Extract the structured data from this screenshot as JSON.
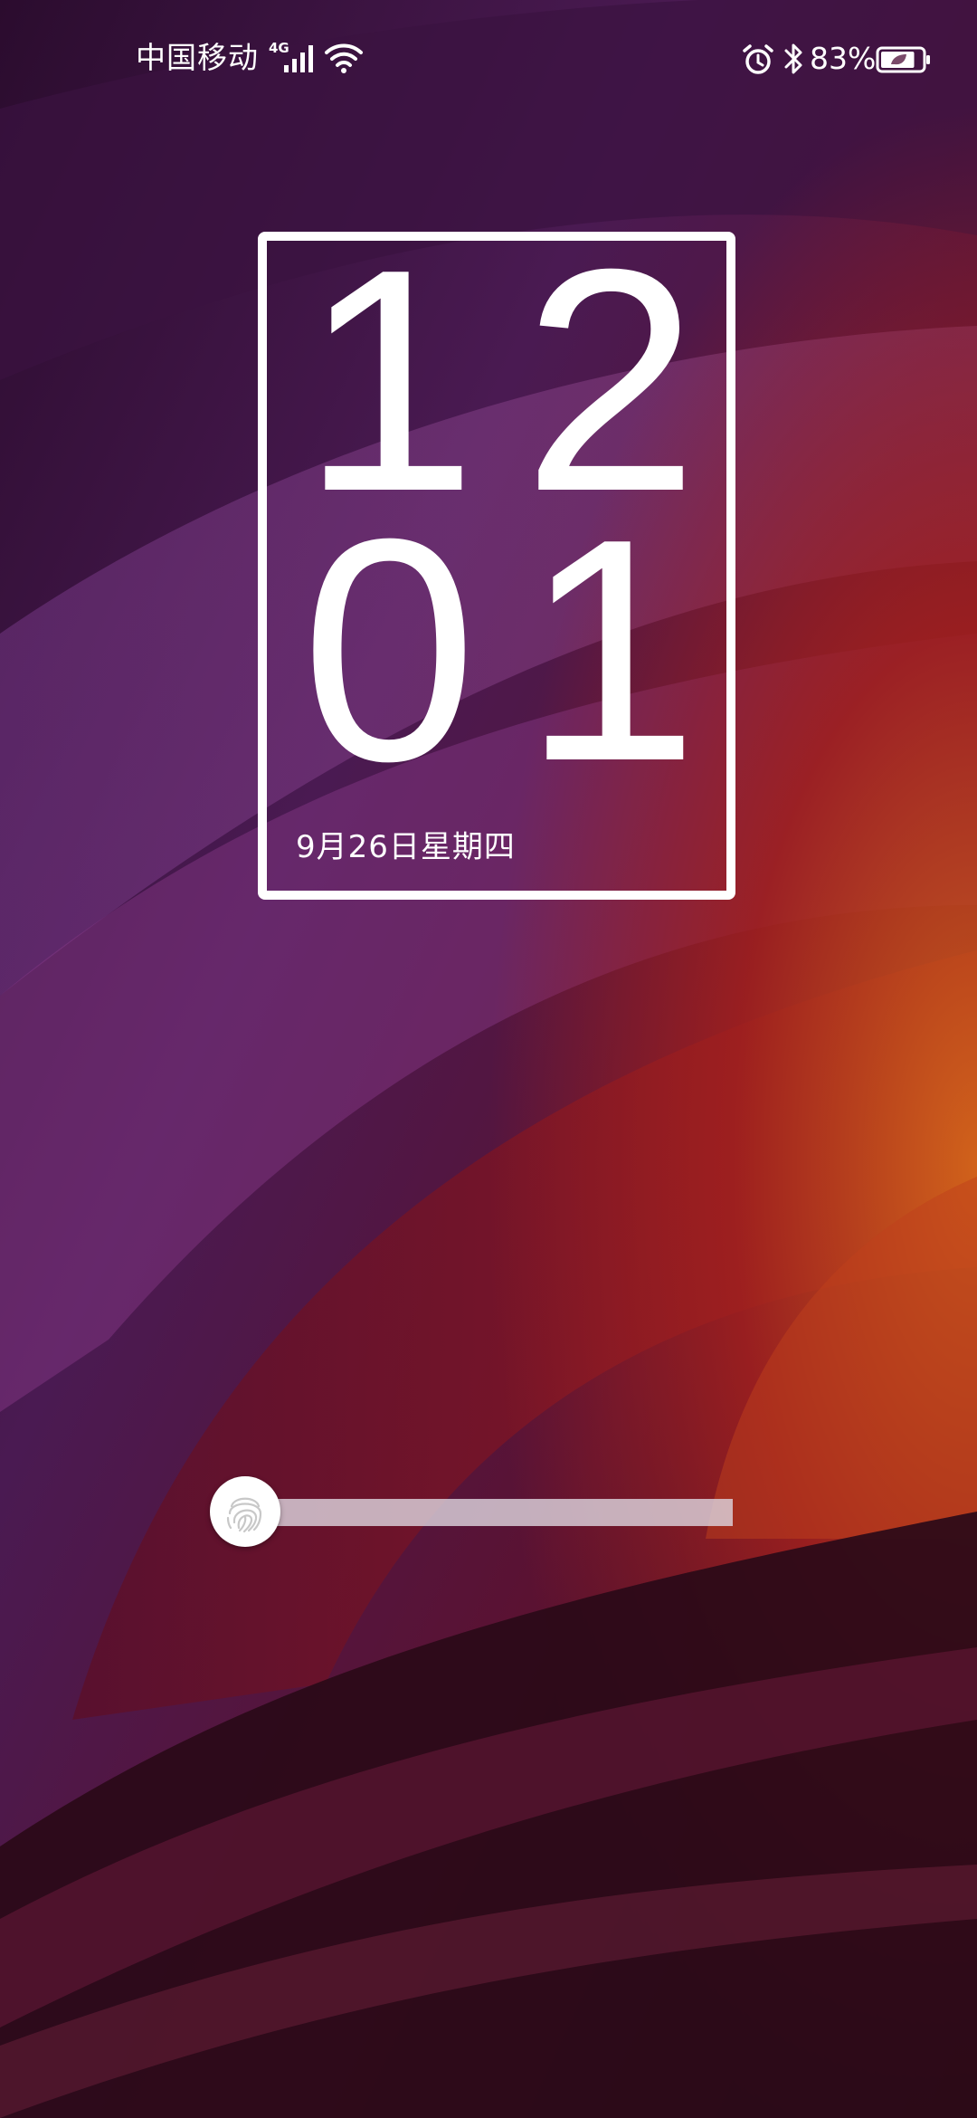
{
  "status_bar": {
    "carrier": "中国移动",
    "network_type": "4G",
    "battery_percent": "83%",
    "icons": [
      "signal-icon",
      "wifi-icon",
      "alarm-icon",
      "bluetooth-icon",
      "battery-icon"
    ],
    "battery_level": 0.83
  },
  "clock": {
    "hour_tens": "1",
    "hour_ones": "2",
    "minute_tens": "0",
    "minute_ones": "1",
    "date": "9月26日星期四"
  },
  "unlock": {
    "icon": "fingerprint-icon",
    "progress": 0
  },
  "colors": {
    "text": "#ffffff",
    "wallpaper_dark": "#2a0d2c",
    "wallpaper_purple": "#6a2a78",
    "wallpaper_red": "#8a1524",
    "wallpaper_orange": "#c85a1a"
  }
}
